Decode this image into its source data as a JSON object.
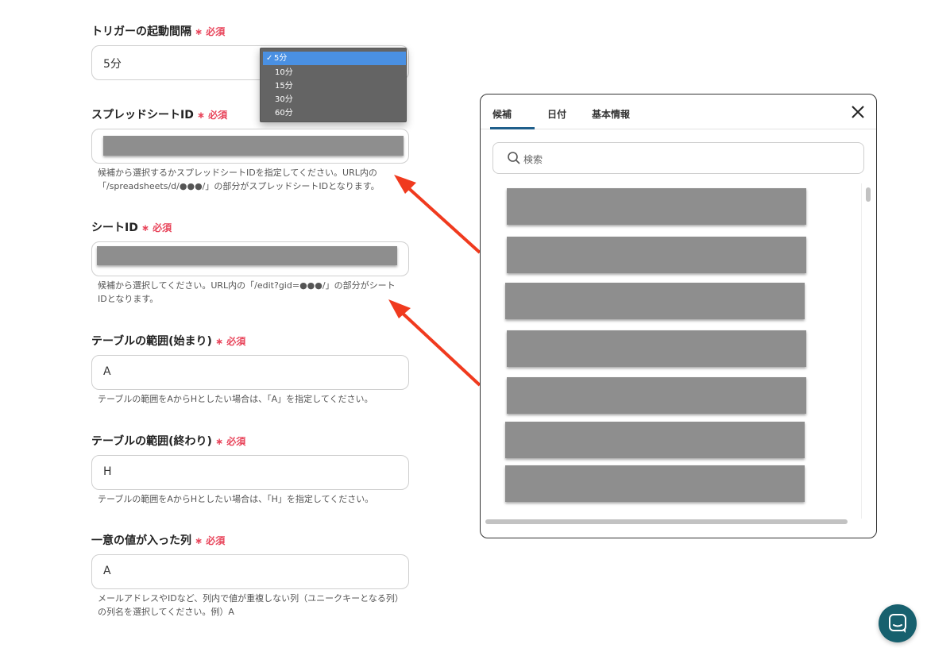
{
  "form": {
    "trigger_interval": {
      "label": "トリガーの起動間隔",
      "required": "必須",
      "value": "5分",
      "options": [
        "5分",
        "10分",
        "15分",
        "30分",
        "60分"
      ],
      "selected_index": 0
    },
    "spreadsheet_id": {
      "label": "スプレッドシートID",
      "required": "必須",
      "help_line1": "候補から選択するかスプレッドシートIDを指定してください。URL内の",
      "help_line2": "「/spreadsheets/d/●●●/」の部分がスプレッドシートIDとなります。"
    },
    "sheet_id": {
      "label": "シートID",
      "required": "必須",
      "help_line1": "候補から選択してください。URL内の「/edit?gid=●●●/」の部分がシート",
      "help_line2": "IDとなります。"
    },
    "table_start": {
      "label": "テーブルの範囲(始まり)",
      "required": "必須",
      "value": "A",
      "help": "テーブルの範囲をAからHとしたい場合は、「A」を指定してください。"
    },
    "table_end": {
      "label": "テーブルの範囲(終わり)",
      "required": "必須",
      "value": "H",
      "help": "テーブルの範囲をAからHとしたい場合は、「H」を指定してください。"
    },
    "unique_column": {
      "label": "一意の値が入った列",
      "required": "必須",
      "value": "A",
      "help_line1": "メールアドレスやIDなど、列内で値が重複しない列（ユニークキーとなる列）",
      "help_line2": "の列名を選択してください。例）A"
    }
  },
  "panel": {
    "tabs": [
      "候補",
      "日付",
      "基本情報"
    ],
    "active_tab": 0,
    "search_placeholder": "検索",
    "items_count_visible": 7
  },
  "colors": {
    "required": "#e8445a",
    "arrow": "#f03a1e",
    "accent": "#1f5f8b",
    "chat_button": "#17606e",
    "dropdown_bg": "#646464",
    "dropdown_selected": "#4a90e2"
  },
  "icons": {
    "close": "close-icon",
    "search": "search-icon",
    "chat": "chat-icon",
    "check": "check-icon"
  }
}
